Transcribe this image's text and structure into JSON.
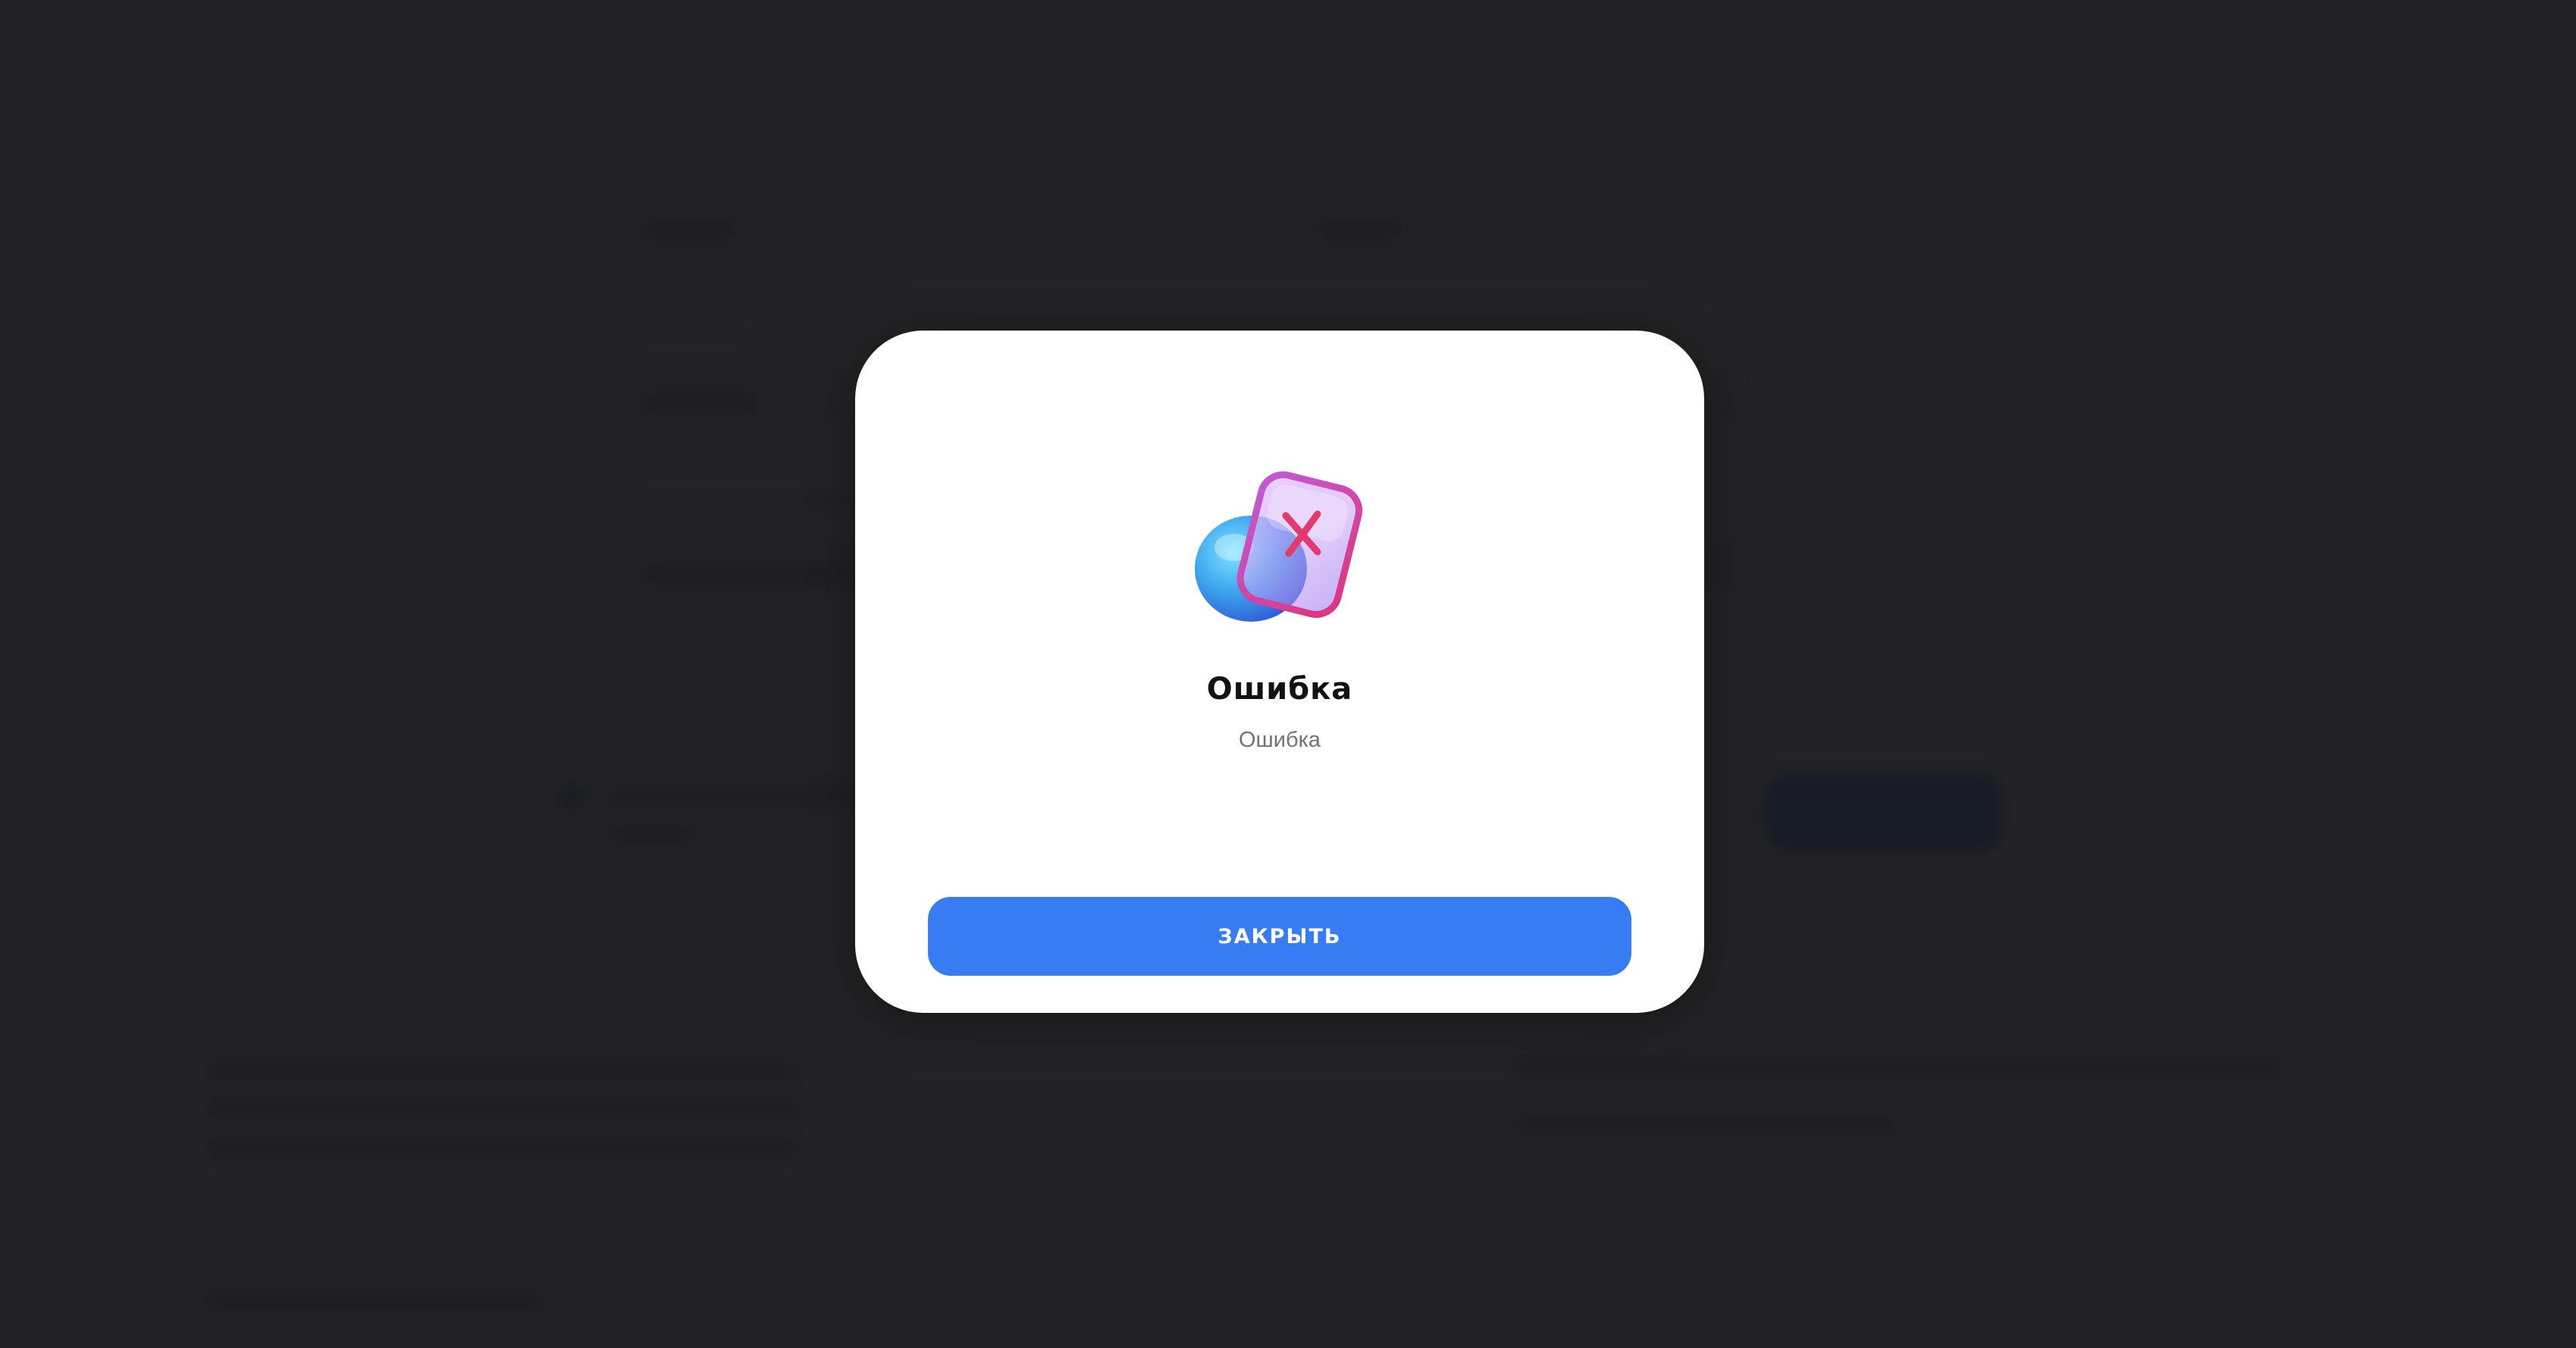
{
  "colors": {
    "overlay": "#121214",
    "modal_background": "#ffffff",
    "accent": "#387cf4",
    "title": "#111214",
    "message": "#6f737a"
  },
  "modal": {
    "icon": "error-cross-icon",
    "title": "Ошибка",
    "message": "Ошибка",
    "close_label": "ЗАКРЫТЬ"
  }
}
